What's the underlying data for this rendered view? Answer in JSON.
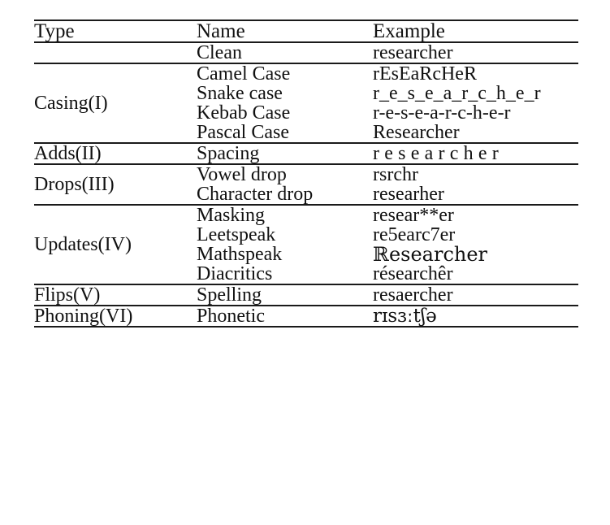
{
  "table": {
    "columns": [
      "Type",
      "Name",
      "Example"
    ],
    "groups": [
      {
        "type": "",
        "rows": [
          {
            "name": "Clean",
            "example": "researcher"
          }
        ]
      },
      {
        "type": "Casing(I)",
        "rows": [
          {
            "name": "Camel Case",
            "example": "rEsEaRcHeR"
          },
          {
            "name": "Snake case",
            "example": "r_e_s_e_a_r_c_h_e_r"
          },
          {
            "name": "Kebab Case",
            "example": "r-e-s-e-a-r-c-h-e-r"
          },
          {
            "name": "Pascal Case",
            "example": "Researcher"
          }
        ]
      },
      {
        "type": "Adds(II)",
        "rows": [
          {
            "name": "Spacing",
            "example": "researcher"
          }
        ]
      },
      {
        "type": "Drops(III)",
        "rows": [
          {
            "name": "Vowel drop",
            "example": "rsrchr"
          },
          {
            "name": "Character drop",
            "example": "researher"
          }
        ]
      },
      {
        "type": "Updates(IV)",
        "rows": [
          {
            "name": "Masking",
            "example": "resear**er"
          },
          {
            "name": "Leetspeak",
            "example": "re5earc7er"
          },
          {
            "name": "Mathspeak",
            "example": "ℝesearcher"
          },
          {
            "name": "Diacritics",
            "example": "résearchêr"
          }
        ]
      },
      {
        "type": "Flips(V)",
        "rows": [
          {
            "name": "Spelling",
            "example": "resaercher"
          }
        ]
      },
      {
        "type": "Phoning(VI)",
        "rows": [
          {
            "name": "Phonetic",
            "example": "rɪsɜːtʃə"
          }
        ]
      }
    ]
  },
  "colors": {
    "rule": "#1a1a1a",
    "text": "#111111",
    "background": "#ffffff"
  }
}
